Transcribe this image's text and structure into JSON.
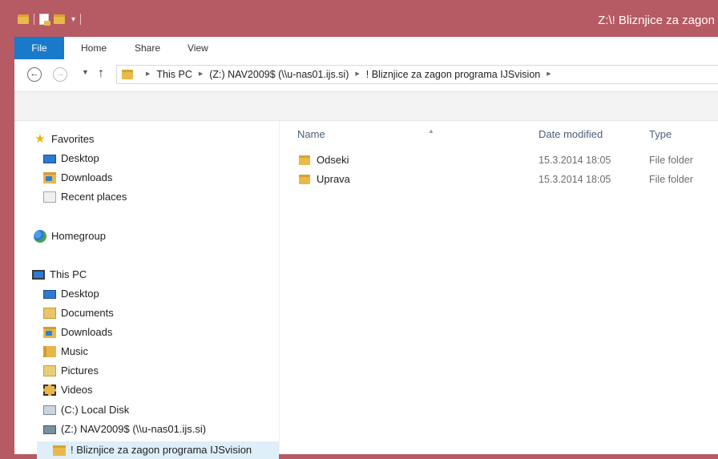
{
  "window": {
    "title": "Z:\\! Bliznjice za zagon",
    "accent_color": "#b65a63",
    "file_tab_color": "#1979ca"
  },
  "quick_access": {
    "icons": [
      "folder-icon",
      "properties-icon",
      "new-folder-icon",
      "customize-caret-icon"
    ]
  },
  "ribbon": {
    "tabs": [
      {
        "label": "File"
      },
      {
        "label": "Home"
      },
      {
        "label": "Share"
      },
      {
        "label": "View"
      }
    ]
  },
  "address": {
    "crumbs": [
      {
        "label": "This PC"
      },
      {
        "label": "(Z:) NAV2009$ (\\\\u-nas01.ijs.si)"
      },
      {
        "label": "! Bliznjice za zagon programa IJSvision"
      }
    ]
  },
  "nav": {
    "favorites": {
      "label": "Favorites",
      "items": [
        {
          "label": "Desktop",
          "icon": "desktop-icon"
        },
        {
          "label": "Downloads",
          "icon": "downloads-icon"
        },
        {
          "label": "Recent places",
          "icon": "recent-places-icon"
        }
      ]
    },
    "homegroup": {
      "label": "Homegroup",
      "icon": "homegroup-icon"
    },
    "this_pc": {
      "label": "This PC",
      "items": [
        {
          "label": "Desktop",
          "icon": "desktop-icon"
        },
        {
          "label": "Documents",
          "icon": "documents-icon"
        },
        {
          "label": "Downloads",
          "icon": "downloads-icon"
        },
        {
          "label": "Music",
          "icon": "music-icon"
        },
        {
          "label": "Pictures",
          "icon": "pictures-icon"
        },
        {
          "label": "Videos",
          "icon": "videos-icon"
        },
        {
          "label": "(C:) Local Disk",
          "icon": "local-disk-icon"
        },
        {
          "label": "(Z:) NAV2009$ (\\\\u-nas01.ijs.si)",
          "icon": "network-drive-icon"
        },
        {
          "label": "! Bliznjice za zagon programa IJSvision",
          "icon": "folder-icon",
          "selected": true
        }
      ]
    }
  },
  "files": {
    "columns": [
      {
        "label": "Name"
      },
      {
        "label": "Date modified"
      },
      {
        "label": "Type"
      }
    ],
    "sorted_by": "Name",
    "rows": [
      {
        "name": "Odseki",
        "date": "15.3.2014 18:05",
        "type": "File folder"
      },
      {
        "name": "Uprava",
        "date": "15.3.2014 18:05",
        "type": "File folder"
      }
    ]
  }
}
